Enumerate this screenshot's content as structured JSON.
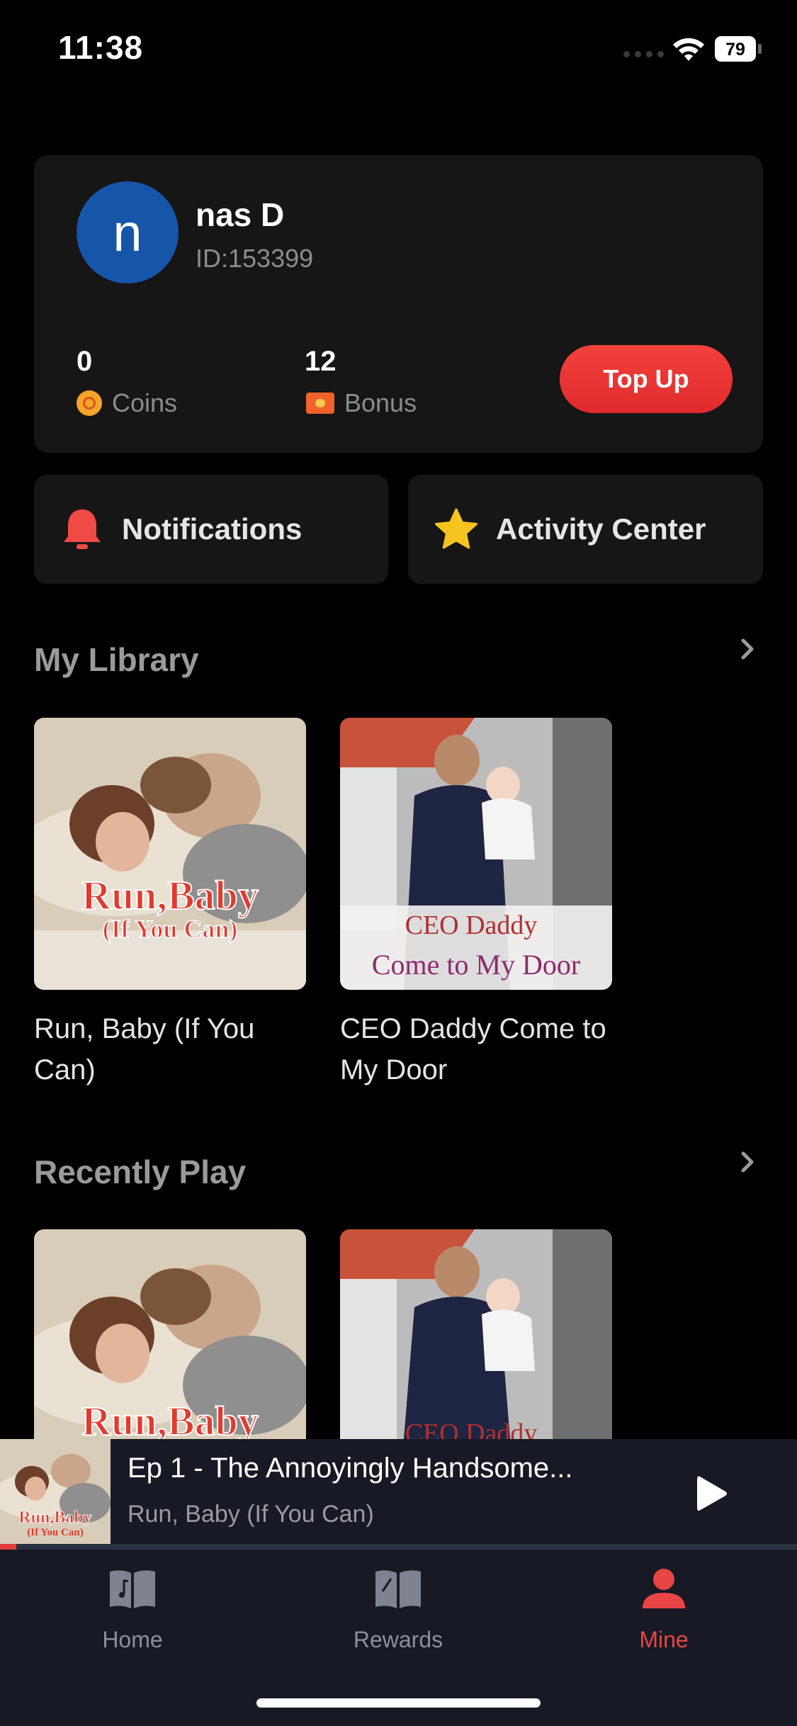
{
  "status_bar": {
    "time": "11:38",
    "battery": "79"
  },
  "profile": {
    "avatar_letter": "n",
    "name": "nas D",
    "id": "ID:153399",
    "coins_value": "0",
    "coins_label": "Coins",
    "bonus_value": "12",
    "bonus_label": "Bonus",
    "topup_label": "Top Up"
  },
  "quick_actions": {
    "notifications": "Notifications",
    "activity_center": "Activity Center"
  },
  "library": {
    "title": "My Library",
    "items": [
      {
        "title": "Run, Baby (If You Can)",
        "cover_line1": "Run,Baby",
        "cover_line2": "(If You Can)"
      },
      {
        "title": "CEO Daddy Come to My Door",
        "cover_line1": "CEO Daddy",
        "cover_line2": "Come to My Door"
      }
    ]
  },
  "recent": {
    "title": "Recently Play",
    "items": [
      {
        "cover_line1": "Run,Baby"
      },
      {
        "cover_line1": "CEO Daddy"
      }
    ]
  },
  "player": {
    "episode": "Ep 1 - The Annoyingly Handsome...",
    "show": "Run, Baby (If You Can)",
    "thumb_line1": "Run,Baby",
    "thumb_line2": "(If You Can)",
    "progress_fraction": 0.02
  },
  "tabs": [
    {
      "label": "Home",
      "active": false
    },
    {
      "label": "Rewards",
      "active": false
    },
    {
      "label": "Mine",
      "active": true
    }
  ],
  "colors": {
    "accent": "#e84545",
    "avatar": "#1556a8",
    "card": "#161616",
    "bar": "#171a24"
  }
}
